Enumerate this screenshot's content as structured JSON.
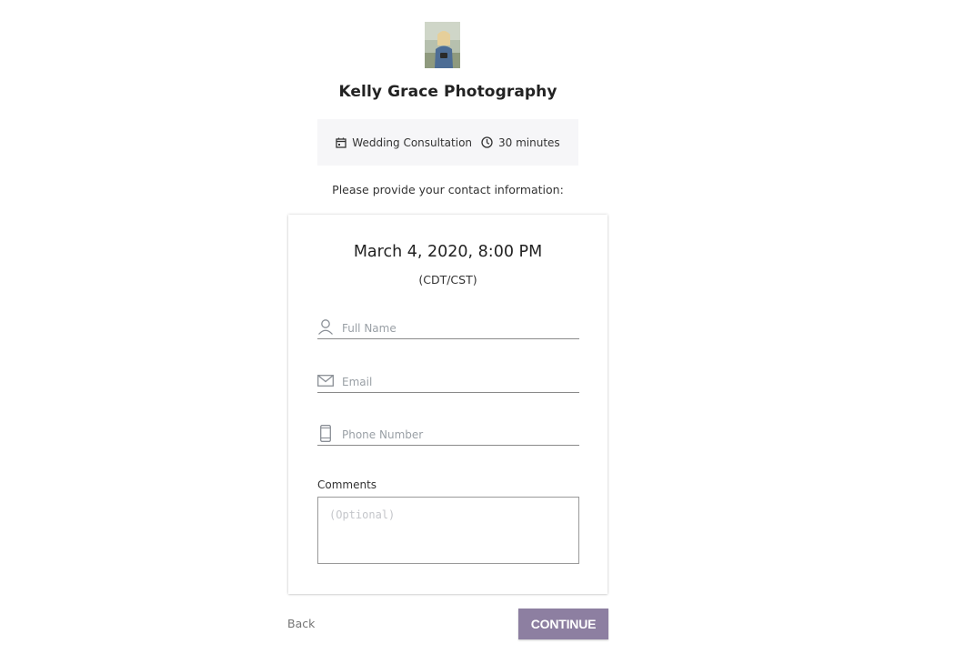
{
  "business": {
    "name": "Kelly Grace Photography",
    "avatar_icon": "profile-photo"
  },
  "appointment": {
    "type": "Wedding Consultation",
    "type_icon": "calendar-icon",
    "duration": "30 minutes",
    "duration_icon": "clock-icon"
  },
  "prompt": "Please provide your contact information:",
  "card": {
    "date_time": "March 4, 2020, 8:00 PM",
    "timezone": "(CDT/CST)"
  },
  "form": {
    "full_name": {
      "value": "",
      "placeholder": "Full Name",
      "icon": "person-icon"
    },
    "email": {
      "value": "",
      "placeholder": "Email",
      "icon": "envelope-icon"
    },
    "phone": {
      "value": "",
      "placeholder": "Phone Number",
      "icon": "phone-icon"
    },
    "comments": {
      "label": "Comments",
      "value": "",
      "placeholder": "(Optional)"
    }
  },
  "actions": {
    "back_label": "Back",
    "continue_label": "CONTINUE"
  },
  "colors": {
    "accent": "#8d7fa1",
    "summary_bg": "#f6f6f8",
    "placeholder": "#9aa0a6"
  }
}
